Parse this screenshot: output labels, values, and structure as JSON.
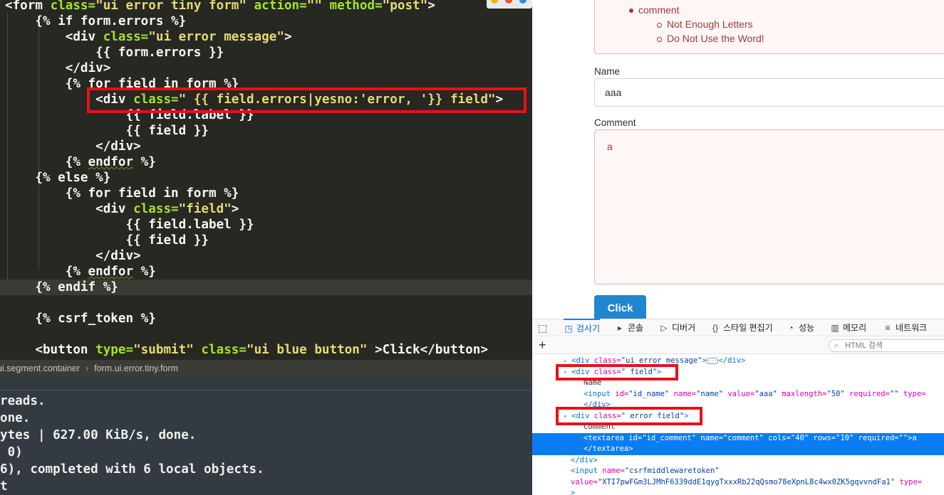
{
  "editor": {
    "lines": [
      [
        {
          "t": "<form ",
          "c": "tag"
        },
        {
          "t": "class=",
          "c": "attr"
        },
        {
          "t": "\"ui error tiny form\" ",
          "c": "str"
        },
        {
          "t": "action=",
          "c": "attr"
        },
        {
          "t": "\"\" ",
          "c": "str"
        },
        {
          "t": "method=",
          "c": "attr"
        },
        {
          "t": "\"post\"",
          "c": "str"
        },
        {
          "t": ">",
          "c": "tag"
        }
      ],
      [
        {
          "t": "    {% if form.errors %}",
          "c": "tpl"
        }
      ],
      [
        {
          "t": "        <div ",
          "c": "tag"
        },
        {
          "t": "class=",
          "c": "attr"
        },
        {
          "t": "\"ui error message\"",
          "c": "str"
        },
        {
          "t": ">",
          "c": "tag"
        }
      ],
      [
        {
          "t": "            {{ form.errors }}",
          "c": "tpl"
        }
      ],
      [
        {
          "t": "        </div>",
          "c": "tag"
        }
      ],
      [
        {
          "t": "        {% for field in form %}",
          "c": "tpl"
        }
      ],
      [
        {
          "t": "            <div ",
          "c": "tag"
        },
        {
          "t": "class=",
          "c": "attr"
        },
        {
          "t": "\" {{ field.errors|yesno:'error, '}} field\"",
          "c": "str"
        },
        {
          "t": ">",
          "c": "tag"
        }
      ],
      [
        {
          "t": "                {{ field.label }}",
          "c": "tpl"
        }
      ],
      [
        {
          "t": "                {{ field }}",
          "c": "tpl"
        }
      ],
      [
        {
          "t": "            </div>",
          "c": "tag"
        }
      ],
      [
        {
          "t": "        {% ",
          "c": "tpl"
        },
        {
          "t": "endfor",
          "c": "wavy"
        },
        {
          "t": " %}",
          "c": "tpl"
        }
      ],
      [
        {
          "t": "    {% else %}",
          "c": "tpl"
        }
      ],
      [
        {
          "t": "        {% for field in form %}",
          "c": "tpl"
        }
      ],
      [
        {
          "t": "            <div ",
          "c": "tag"
        },
        {
          "t": "class=",
          "c": "attr"
        },
        {
          "t": "\"field\"",
          "c": "str"
        },
        {
          "t": ">",
          "c": "tag"
        }
      ],
      [
        {
          "t": "                {{ field.label }}",
          "c": "tpl"
        }
      ],
      [
        {
          "t": "                {{ field }}",
          "c": "tpl"
        }
      ],
      [
        {
          "t": "            </div>",
          "c": "tag"
        }
      ],
      [
        {
          "t": "        {% ",
          "c": "tpl"
        },
        {
          "t": "endfor",
          "c": "wavy"
        },
        {
          "t": " %}",
          "c": "tpl"
        }
      ],
      [
        {
          "t": "    {% endif %}",
          "c": "tpl"
        }
      ],
      [
        {
          "t": "",
          "c": "tpl"
        }
      ],
      [
        {
          "t": "    {% csrf_token %}",
          "c": "tpl"
        }
      ],
      [
        {
          "t": "",
          "c": "tpl"
        }
      ],
      [
        {
          "t": "    <button ",
          "c": "tag"
        },
        {
          "t": "type=",
          "c": "attr"
        },
        {
          "t": "\"submit\" ",
          "c": "str"
        },
        {
          "t": "class=",
          "c": "attr"
        },
        {
          "t": "\"ui blue button\" ",
          "c": "str"
        },
        {
          "t": ">Click</button>",
          "c": "tag"
        }
      ]
    ],
    "highlighted_line_index": 18,
    "breadcrumb": [
      "ui.segment.container",
      "form.ui.error.tiny.form"
    ],
    "breadcrumb_sep": "›"
  },
  "terminal": {
    "lines": [
      "reads.",
      "one.",
      "ytes | 627.00 KiB/s, done.",
      " 0)",
      "6), completed with 6 local objects.",
      "t"
    ]
  },
  "page": {
    "errors": {
      "field": "comment",
      "messages": [
        "Not Enough Letters",
        "Do Not Use the Word!"
      ]
    },
    "name_label": "Name",
    "name_value": "aaa",
    "comment_label": "Comment",
    "comment_value": "a",
    "submit_label": "Click"
  },
  "devtools": {
    "tabs": [
      {
        "icon": "◳",
        "label": "검사기",
        "active": true
      },
      {
        "icon": "▸",
        "label": "콘솔",
        "active": false
      },
      {
        "icon": "▷",
        "label": "디버거",
        "active": false
      },
      {
        "icon": "{}",
        "label": "스타일 편집기",
        "active": false
      },
      {
        "icon": "◔",
        "label": "성능",
        "active": false
      },
      {
        "icon": "▥",
        "label": "메모리",
        "active": false
      },
      {
        "icon": "≡",
        "label": "네트워크",
        "active": false
      }
    ],
    "search_placeholder": "HTML 검색",
    "markup": [
      {
        "indent": 6,
        "tri": "▸",
        "parts": [
          [
            "tag",
            "<div "
          ],
          [
            "an",
            "class="
          ],
          [
            "av",
            "\"ui error message\""
          ],
          [
            "tag",
            ">"
          ],
          [
            "dots",
            "···"
          ],
          [
            "tag",
            "</div>"
          ]
        ]
      },
      {
        "indent": 6,
        "tri": "▾",
        "parts": [
          [
            "tag",
            "<div "
          ],
          [
            "an",
            "class="
          ],
          [
            "av",
            "\" field\""
          ],
          [
            "tag",
            ">"
          ]
        ]
      },
      {
        "indent": 8,
        "tri": "",
        "parts": [
          [
            "tx",
            "Name"
          ]
        ]
      },
      {
        "indent": 8,
        "tri": "",
        "parts": [
          [
            "tag",
            "<input "
          ],
          [
            "an",
            "id="
          ],
          [
            "av",
            "\"id_name\" "
          ],
          [
            "an",
            "name="
          ],
          [
            "av",
            "\"name\" "
          ],
          [
            "an",
            "value="
          ],
          [
            "av",
            "\"aaa\" "
          ],
          [
            "an",
            "maxlength="
          ],
          [
            "av",
            "\"50\" "
          ],
          [
            "an",
            "required="
          ],
          [
            "av",
            "\"\" "
          ],
          [
            "an",
            "type="
          ]
        ]
      },
      {
        "indent": 8,
        "tri": "",
        "parts": [
          [
            "tag",
            "</div>"
          ]
        ]
      },
      {
        "indent": 6,
        "tri": "▾",
        "parts": [
          [
            "tag",
            "<div "
          ],
          [
            "an",
            "class="
          ],
          [
            "av",
            "\" error field\""
          ],
          [
            "tag",
            ">"
          ]
        ]
      },
      {
        "indent": 8,
        "tri": "",
        "parts": [
          [
            "tx",
            "Comment"
          ]
        ]
      },
      {
        "indent": 8,
        "tri": "",
        "sel": true,
        "parts": [
          [
            "tag",
            "<textarea "
          ],
          [
            "an",
            "id="
          ],
          [
            "av",
            "\"id_comment\" "
          ],
          [
            "an",
            "name="
          ],
          [
            "av",
            "\"comment\" "
          ],
          [
            "an",
            "cols="
          ],
          [
            "av",
            "\"40\" "
          ],
          [
            "an",
            "rows="
          ],
          [
            "av",
            "\"10\" "
          ],
          [
            "an",
            "required="
          ],
          [
            "av",
            "\"\""
          ],
          [
            "tag",
            ">a"
          ]
        ]
      },
      {
        "indent": 8,
        "tri": "",
        "sel": true,
        "parts": [
          [
            "tag",
            "</textarea>"
          ]
        ]
      },
      {
        "indent": 6,
        "tri": "",
        "parts": [
          [
            "tag",
            "</div>"
          ]
        ]
      },
      {
        "indent": 6,
        "tri": "",
        "parts": [
          [
            "tag",
            "<input "
          ],
          [
            "an",
            "name="
          ],
          [
            "av",
            "\"csrfmiddlewaretoken\""
          ]
        ]
      },
      {
        "indent": 6,
        "tri": "",
        "parts": [
          [
            "an",
            "value="
          ],
          [
            "av",
            "\"XTI7pwFGm3LJMhF6339ddE1qygTxxxRb22qQsmo78eXpnL8c4wx0ZK5gqvvndFa1\" "
          ],
          [
            "an",
            "type="
          ]
        ]
      },
      {
        "indent": 6,
        "tri": "",
        "parts": [
          [
            "tag",
            ">"
          ]
        ]
      }
    ]
  },
  "colors": {
    "editor_bg": "#272822",
    "highlight_box": "#e8101a",
    "error_text": "#9f3a38",
    "button_blue": "#2185d0",
    "devtools_selection": "#0a7df5"
  }
}
